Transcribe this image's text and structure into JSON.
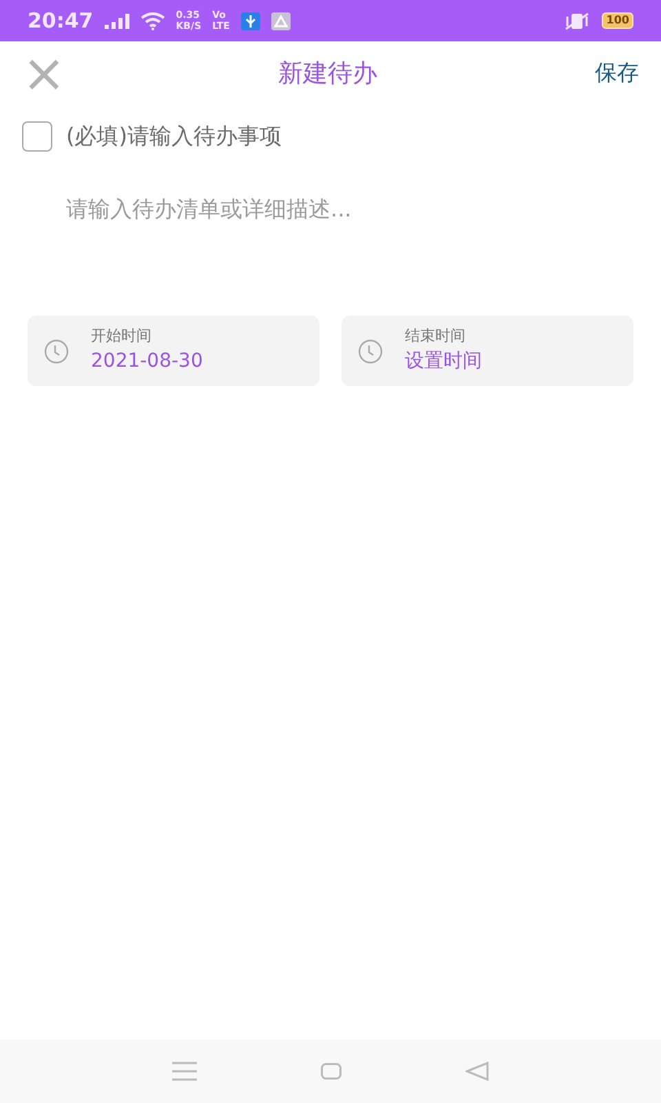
{
  "status_bar": {
    "time": "20:47",
    "speed": "0.35",
    "speed_unit": "KB/S",
    "network_top": "Vo",
    "network_bottom": "LTE",
    "battery": "100"
  },
  "header": {
    "close": "×",
    "title": "新建待办",
    "save": "保存"
  },
  "todo": {
    "checked": false,
    "placeholder": "(必填)请输入待办事项"
  },
  "description": {
    "placeholder": "请输入待办清单或详细描述..."
  },
  "times": [
    {
      "label": "开始时间",
      "value": "2021-08-30"
    },
    {
      "label": "结束时间",
      "value": "设置时间"
    }
  ]
}
